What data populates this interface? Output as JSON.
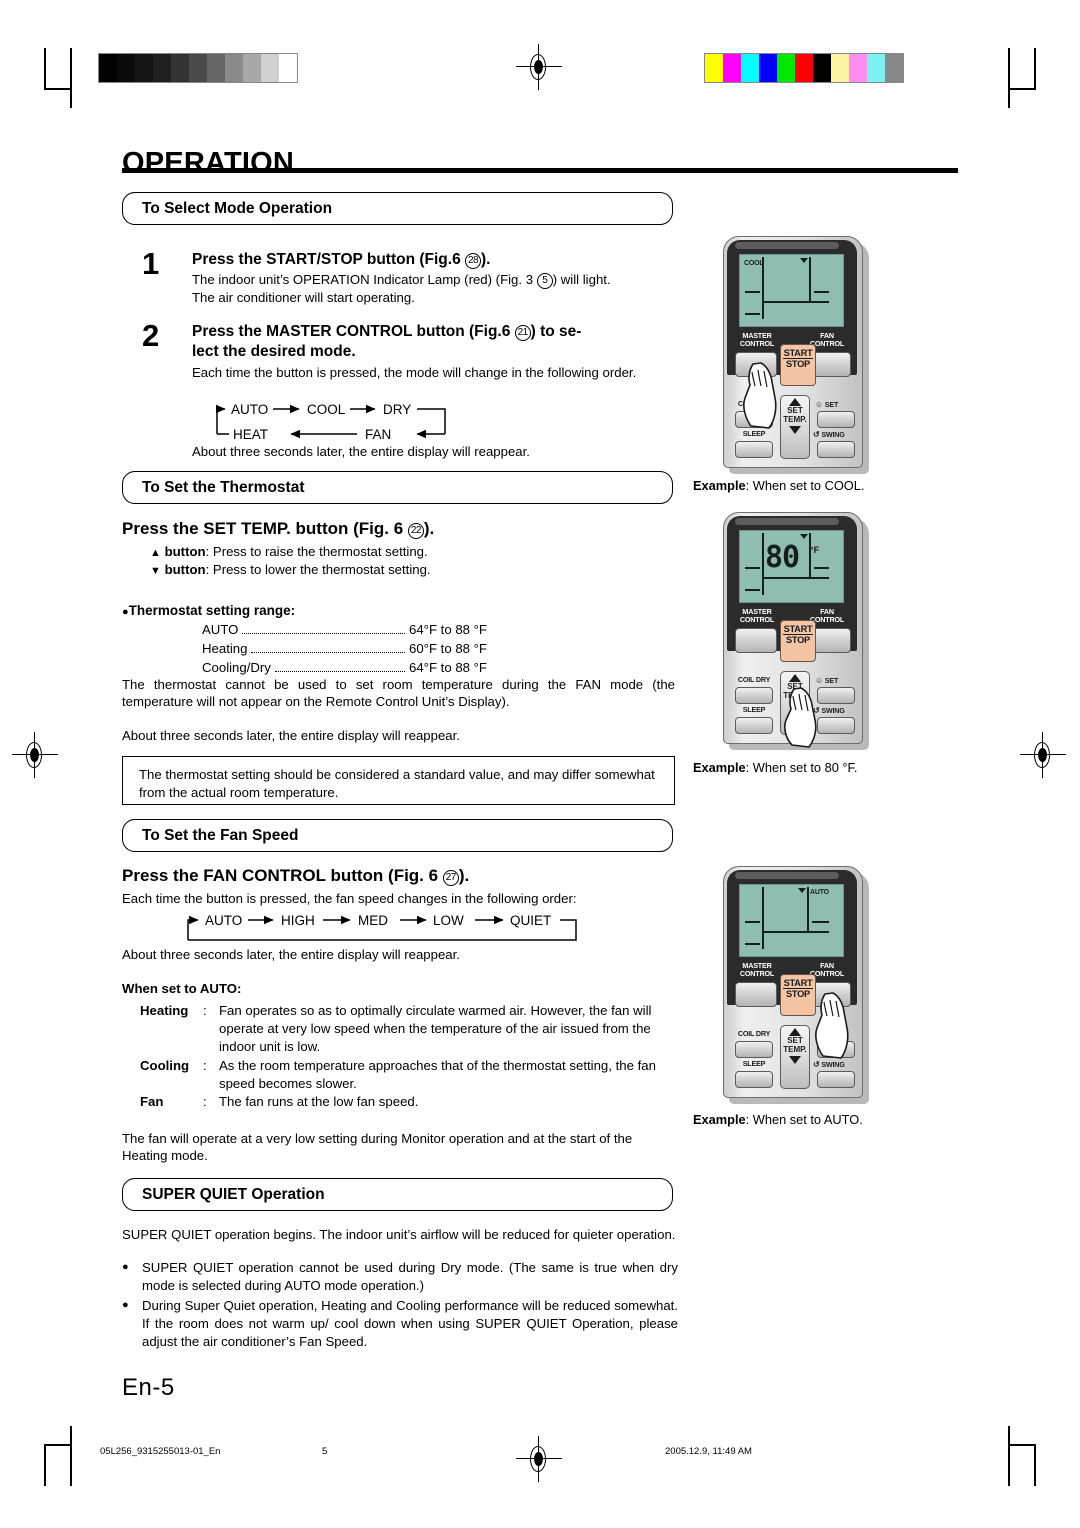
{
  "document": {
    "title": "OPERATION",
    "page_label": "En-5",
    "footer_left": "05L256_9315255013-01_En",
    "footer_page": "5",
    "footer_right": "2005.12.9, 11:49 AM"
  },
  "sections": {
    "select_mode": {
      "header": "To Select Mode Operation",
      "step1": {
        "number": "1",
        "heading_pre": "Press the START/STOP button (Fig.6 ",
        "heading_circled": "28",
        "heading_post": ").",
        "body_line1_pre": "The indoor unit’s OPERATION Indicator Lamp (red) (Fig. 3 ",
        "body_line1_circled": "5",
        "body_line1_post": ") will light.",
        "body_line2": "The air conditioner will start operating."
      },
      "step2": {
        "number": "2",
        "heading_pre": "Press the MASTER CONTROL button (Fig.6 ",
        "heading_circled": "21",
        "heading_post": ") to se-",
        "heading_line2": "lect the desired mode.",
        "body": "Each time the button is pressed, the mode will change in the following order.",
        "flow_top": [
          "AUTO",
          "COOL",
          "DRY"
        ],
        "flow_bottom": [
          "HEAT",
          "FAN"
        ],
        "footer_note": "About three seconds later, the entire display will reappear."
      }
    },
    "thermostat": {
      "header": "To Set the Thermostat",
      "heading_pre": "Press the SET TEMP. button (Fig. 6 ",
      "heading_circled": "22",
      "heading_post": ").",
      "up_label": "button",
      "up_text": ": Press to raise the thermostat setting.",
      "down_label": "button",
      "down_text": ": Press to lower the thermostat setting.",
      "range_title": "Thermostat setting range:",
      "ranges": [
        {
          "label": "AUTO",
          "value": "64°F to 88 °F"
        },
        {
          "label": "Heating",
          "value": "60°F to 88 °F"
        },
        {
          "label": "Cooling/Dry",
          "value": "64°F to 88 °F"
        }
      ],
      "note1": "The thermostat cannot be used to set room temperature during the FAN mode (the temperature will not appear on the Remote Control Unit’s Display).",
      "note2": "About three seconds later, the entire display will reappear.",
      "boxed_note": "The thermostat setting should be considered a standard value, and may differ somewhat from the actual room temperature."
    },
    "fan_speed": {
      "header": "To Set the Fan Speed",
      "heading_pre": "Press the FAN CONTROL button (Fig. 6 ",
      "heading_circled": "27",
      "heading_post": ").",
      "body": "Each time the button is pressed, the fan speed changes in the following order:",
      "flow": [
        "AUTO",
        "HIGH",
        "MED",
        "LOW",
        "QUIET"
      ],
      "footer_note": "About three seconds later, the entire display will reappear.",
      "auto_title": "When set to AUTO:",
      "modes": [
        {
          "term": "Heating",
          "desc": "Fan operates so as to optimally circulate warmed air. However, the fan will operate at very low speed when the temperature of the air issued from the indoor unit is low."
        },
        {
          "term": "Cooling",
          "desc": "As the room temperature approaches that of the thermostat setting, the fan speed becomes slower."
        },
        {
          "term": "Fan",
          "desc": "The fan runs at the low fan speed."
        }
      ],
      "closing": "The fan will operate at a very low setting during Monitor operation and at the start of the Heating mode."
    },
    "super_quiet": {
      "header": "SUPER QUIET Operation",
      "intro": "SUPER QUIET operation begins. The indoor unit’s airflow will be reduced for quieter operation.",
      "bullets": [
        "SUPER QUIET operation cannot be used during Dry mode. (The same is true when dry mode is selected during AUTO mode operation.)",
        "During Super Quiet operation, Heating and Cooling performance will be reduced somewhat. If the room does not warm up/ cool down when using SUPER QUIET Operation, please adjust the air conditioner’s Fan Speed."
      ]
    }
  },
  "remotes": [
    {
      "id": "remote-cool",
      "lcd_mode": "COOL",
      "lcd_digits": "",
      "lcd_unit": "",
      "pressed_button": "MASTER CONTROL",
      "buttons": {
        "master_control": "MASTER\nCONTROL",
        "master_control_l1": "MASTER",
        "master_control_l2": "CONTROL",
        "fan_control_l1": "FAN",
        "fan_control_l2": "CONTROL",
        "start": "START",
        "stop": "STOP",
        "coil_dry": "COIL DRY",
        "sleep": "SLEEP",
        "set_temp_l1": "SET",
        "set_temp_l2": "TEMP.",
        "set": "SET",
        "swing": "SWING"
      },
      "caption_bold": "Example",
      "caption_rest": ": When set to COOL."
    },
    {
      "id": "remote-80f",
      "lcd_mode": "",
      "lcd_digits": "80",
      "lcd_unit": "°F",
      "pressed_button": "SET TEMP.",
      "caption_bold": "Example",
      "caption_rest": ": When set to 80 °F."
    },
    {
      "id": "remote-auto",
      "lcd_mode": "AUTO",
      "lcd_digits": "",
      "lcd_unit": "",
      "pressed_button": "FAN CONTROL",
      "caption_bold": "Example",
      "caption_rest": ": When set to AUTO."
    }
  ],
  "colors": {
    "lcd": "#90bdb2",
    "start_stop": "#f3c5a4",
    "remote_dark": "#2b2b2b",
    "ink": "#000000"
  },
  "colorbar_gray": [
    "#000000",
    "#0a0a0a",
    "#151515",
    "#1f1f1f",
    "#333333",
    "#4a4a4a",
    "#666666",
    "#8a8a8a",
    "#a8a8a8",
    "#d0d0d0",
    "#ffffff"
  ],
  "colorbar_color": [
    "#ffff00",
    "#ff00ff",
    "#00ffff",
    "#0000ff",
    "#00e800",
    "#ff0000",
    "#000000",
    "#fbf4a0",
    "#ff8cf0",
    "#7df2f2",
    "#888888"
  ]
}
